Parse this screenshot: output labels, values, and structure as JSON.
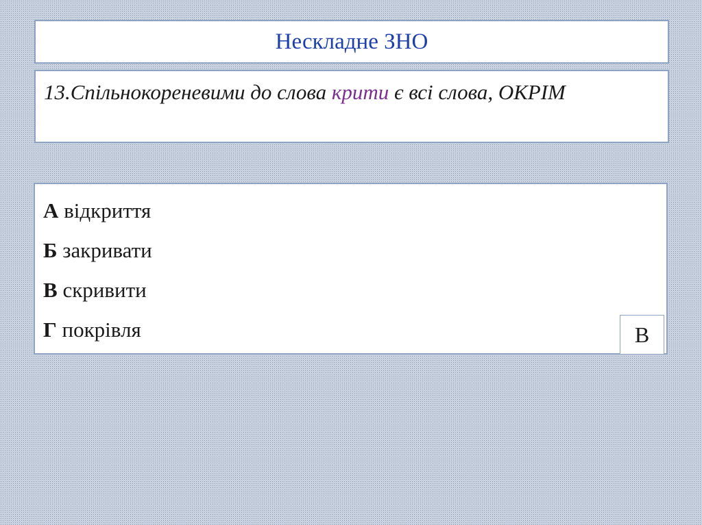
{
  "title": "Нескладне ЗНО",
  "question": {
    "prefix": "13.Спільнокореневими до слова ",
    "keyword": "крити",
    "suffix": " є всі слова, ОКРІМ"
  },
  "options": [
    {
      "letter": "А",
      "text": "відкриття"
    },
    {
      "letter": "Б",
      "text": "закривати"
    },
    {
      "letter": "В",
      "text": "скривити"
    },
    {
      "letter": "Г",
      "text": "покрівля"
    }
  ],
  "answer": "В",
  "colors": {
    "title": "#1d3fae",
    "keyword": "#7a2f8f",
    "border": "#8ea3c4"
  }
}
